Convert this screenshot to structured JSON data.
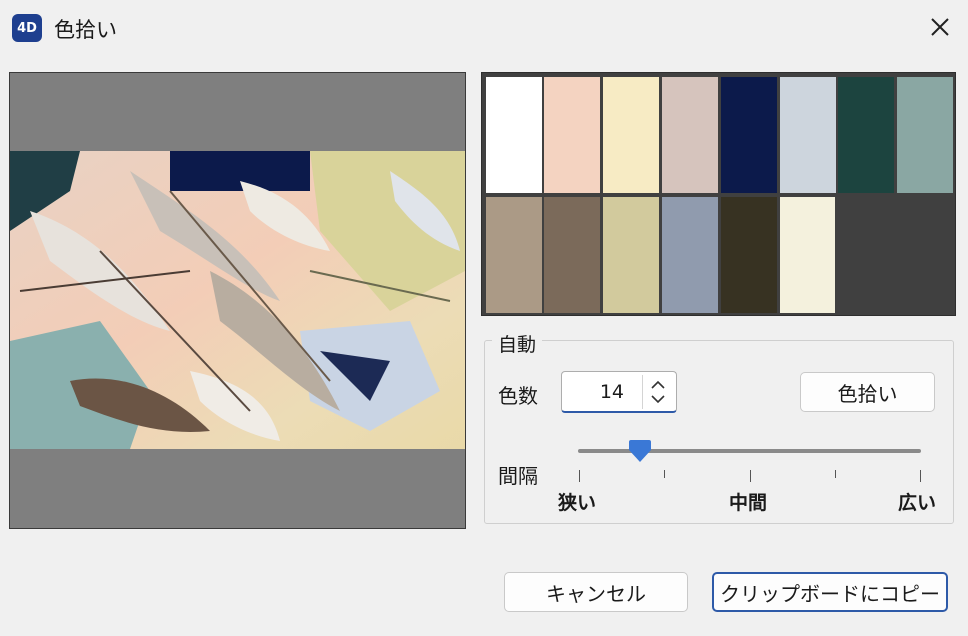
{
  "window": {
    "app_icon_text": "4D",
    "title": "色拾い"
  },
  "swatches": [
    {
      "color": "#ffffff"
    },
    {
      "color": "#f4d3c1"
    },
    {
      "color": "#f7ebc4"
    },
    {
      "color": "#d6c4bd"
    },
    {
      "color": "#0c1a4b"
    },
    {
      "color": "#cdd5dd"
    },
    {
      "color": "#1c443f"
    },
    {
      "color": "#8aa7a3"
    },
    {
      "color": "#ab9a86"
    },
    {
      "color": "#7b6a5a"
    },
    {
      "color": "#d2ca9d"
    },
    {
      "color": "#909bae"
    },
    {
      "color": "#373222"
    },
    {
      "color": "#f4f1dd"
    }
  ],
  "auto_group": {
    "label": "自動",
    "count_label": "色数",
    "count_value": "14",
    "pick_button": "色拾い",
    "interval_label": "間隔",
    "interval_ticks": [
      "狭い",
      "中間",
      "広い"
    ],
    "interval_value": 0.18
  },
  "buttons": {
    "cancel": "キャンセル",
    "copy": "クリップボードにコピー"
  },
  "colors": {
    "accent": "#3a78d6",
    "preview_background": "#7f7f7f"
  }
}
